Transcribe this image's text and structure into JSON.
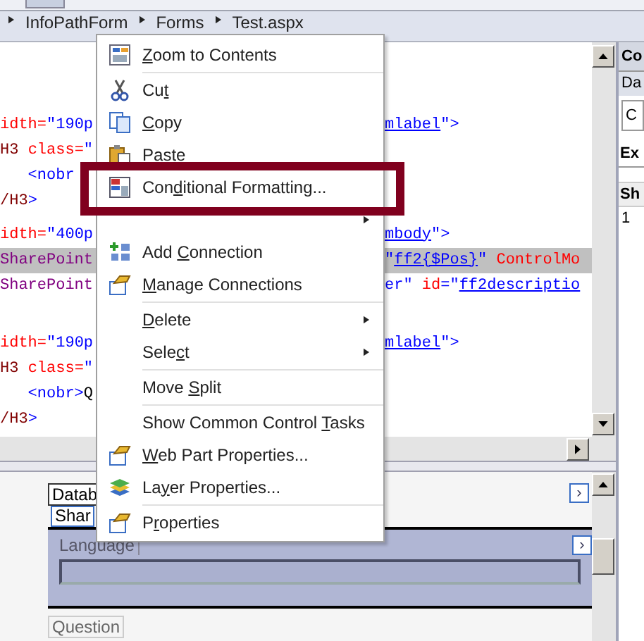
{
  "breadcrumb": [
    "InfoPathForm",
    "Forms",
    "Test.aspx"
  ],
  "code_blocks": [
    {
      "lines": [
        {
          "highlighted": false,
          "left": [
            {
              "text": "idth=",
              "color": "#ff0000"
            },
            {
              "text": "\"190p",
              "color": "#0000ff"
            }
          ],
          "right": [
            {
              "text": "mlabel",
              "color": "#0000ff",
              "link": true
            },
            {
              "text": "\">",
              "color": "#0000ff"
            }
          ]
        },
        {
          "highlighted": false,
          "left": [
            {
              "text": "H3 ",
              "color": "#800000"
            },
            {
              "text": "class=",
              "color": "#ff0000"
            },
            {
              "text": "\"",
              "color": "#0000ff"
            }
          ]
        },
        {
          "highlighted": false,
          "left": [
            {
              "text": "   <nobr",
              "color": "#0000ff"
            }
          ]
        },
        {
          "highlighted": false,
          "left": [
            {
              "text": "/H3",
              "color": "#800000"
            },
            {
              "text": ">",
              "color": "#0000ff"
            }
          ]
        }
      ]
    },
    {
      "lines": [
        {
          "highlighted": false,
          "left": [
            {
              "text": "idth=",
              "color": "#ff0000"
            },
            {
              "text": "\"400p",
              "color": "#0000ff"
            }
          ],
          "right": [
            {
              "text": "mbody",
              "color": "#0000ff",
              "link": true
            },
            {
              "text": "\">",
              "color": "#0000ff"
            }
          ]
        },
        {
          "highlighted": true,
          "left": [
            {
              "text": "SharePoint",
              "color": "#800080"
            }
          ],
          "right": [
            {
              "text": "\"",
              "color": "#0000ff"
            },
            {
              "text": "ff2{$Pos}",
              "color": "#0000ff",
              "link": true
            },
            {
              "text": "\" ",
              "color": "#0000ff"
            },
            {
              "text": "ControlMo",
              "color": "#ff0000"
            }
          ]
        },
        {
          "highlighted": false,
          "left": [
            {
              "text": "SharePoint",
              "color": "#800080"
            }
          ],
          "right": [
            {
              "text": "er\" ",
              "color": "#0000ff"
            },
            {
              "text": "id",
              "color": "#ff0000"
            },
            {
              "text": "=\"",
              "color": "#0000ff"
            },
            {
              "text": "ff2descriptio",
              "color": "#0000ff",
              "link": true
            }
          ]
        }
      ]
    },
    {
      "lines": [
        {
          "highlighted": false,
          "left": [
            {
              "text": "idth=",
              "color": "#ff0000"
            },
            {
              "text": "\"190p",
              "color": "#0000ff"
            }
          ],
          "right": [
            {
              "text": "mlabel",
              "color": "#0000ff",
              "link": true
            },
            {
              "text": "\">",
              "color": "#0000ff"
            }
          ]
        },
        {
          "highlighted": false,
          "left": [
            {
              "text": "H3 ",
              "color": "#800000"
            },
            {
              "text": "class=",
              "color": "#ff0000"
            },
            {
              "text": "\"",
              "color": "#0000ff"
            }
          ]
        },
        {
          "highlighted": false,
          "left": [
            {
              "text": "   <nobr>",
              "color": "#0000ff"
            },
            {
              "text": "Q",
              "color": "#000000"
            }
          ]
        },
        {
          "highlighted": false,
          "left": [
            {
              "text": "/H3",
              "color": "#800000"
            },
            {
              "text": ">",
              "color": "#0000ff"
            }
          ]
        }
      ]
    }
  ],
  "design": {
    "tabs": [
      "Datab",
      "Shar"
    ],
    "section_label": "Language",
    "field_label": "Question",
    "expand_buttons": [
      "›",
      "›"
    ]
  },
  "side_panel": {
    "title": "Co",
    "tab": "Da",
    "button": "C",
    "heading": "Ex",
    "column": "Sh",
    "cell": "1"
  },
  "context_menu": [
    {
      "kind": "item",
      "key": "Z",
      "after": "oom to Contents",
      "submenu": false
    },
    {
      "kind": "separator"
    },
    {
      "kind": "item",
      "before": "Cu",
      "key": "t",
      "submenu": false
    },
    {
      "kind": "item",
      "key": "C",
      "after": "opy",
      "submenu": false
    },
    {
      "kind": "item",
      "key": "P",
      "after": "aste",
      "submenu": false
    },
    {
      "kind": "item",
      "before": "Con",
      "key": "d",
      "after": "itional Formatting...",
      "submenu": false,
      "outlined": true
    },
    {
      "kind": "item",
      "submenu": true
    },
    {
      "kind": "item",
      "before": "Add ",
      "key": "C",
      "after": "onnection",
      "submenu": false
    },
    {
      "kind": "item",
      "key": "M",
      "after": "anage Connections",
      "submenu": false
    },
    {
      "kind": "separator"
    },
    {
      "kind": "item",
      "key": "D",
      "after": "elete",
      "submenu": true
    },
    {
      "kind": "item",
      "before": "Sele",
      "key": "c",
      "after": "t",
      "submenu": true
    },
    {
      "kind": "separator"
    },
    {
      "kind": "item",
      "before": "Move ",
      "key": "S",
      "after": "plit",
      "submenu": false
    },
    {
      "kind": "separator"
    },
    {
      "kind": "item",
      "before": "Show Common Control ",
      "key": "T",
      "after": "asks",
      "submenu": false
    },
    {
      "kind": "item",
      "key": "W",
      "after": "eb Part Properties...",
      "submenu": false
    },
    {
      "kind": "item",
      "before": "La",
      "key": "y",
      "after": "er Properties...",
      "submenu": false
    },
    {
      "kind": "separator"
    },
    {
      "kind": "item",
      "before": "P",
      "key": "r",
      "after": "operties",
      "submenu": false
    }
  ]
}
